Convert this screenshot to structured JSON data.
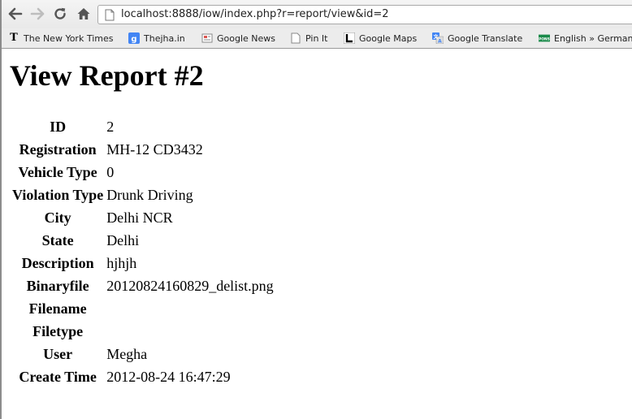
{
  "browser": {
    "url": "localhost:8888/iow/index.php?r=report/view&id=2",
    "bookmarks": [
      {
        "label": "The New York Times",
        "icon": "nyt-icon"
      },
      {
        "label": "Thejha.in",
        "icon": "google-icon"
      },
      {
        "label": "Google News",
        "icon": "news-icon"
      },
      {
        "label": "Pin It",
        "icon": "bookmarklet-icon"
      },
      {
        "label": "Google Maps",
        "icon": "maps-icon"
      },
      {
        "label": "Google Translate",
        "icon": "translate-icon"
      },
      {
        "label": "English » German",
        "icon": "pons-icon"
      }
    ]
  },
  "page": {
    "title": "View Report #2",
    "rows": [
      {
        "label": "ID",
        "value": "2"
      },
      {
        "label": "Registration",
        "value": "MH-12 CD3432"
      },
      {
        "label": "Vehicle Type",
        "value": "0"
      },
      {
        "label": "Violation Type",
        "value": "Drunk Driving"
      },
      {
        "label": "City",
        "value": "Delhi NCR"
      },
      {
        "label": "State",
        "value": "Delhi"
      },
      {
        "label": "Description",
        "value": "hjhjh"
      },
      {
        "label": "Binaryfile",
        "value": "20120824160829_delist.png"
      },
      {
        "label": "Filename",
        "value": ""
      },
      {
        "label": "Filetype",
        "value": ""
      },
      {
        "label": "User",
        "value": "Megha"
      },
      {
        "label": "Create Time",
        "value": "2012-08-24 16:47:29"
      }
    ]
  },
  "colors": {
    "chrome_bg": "#ececec",
    "nav_icon": "#4a4a4a",
    "nav_icon_disabled": "#b8b8b8",
    "google_blue": "#4285f4",
    "pons_green": "#1a8a4a"
  }
}
